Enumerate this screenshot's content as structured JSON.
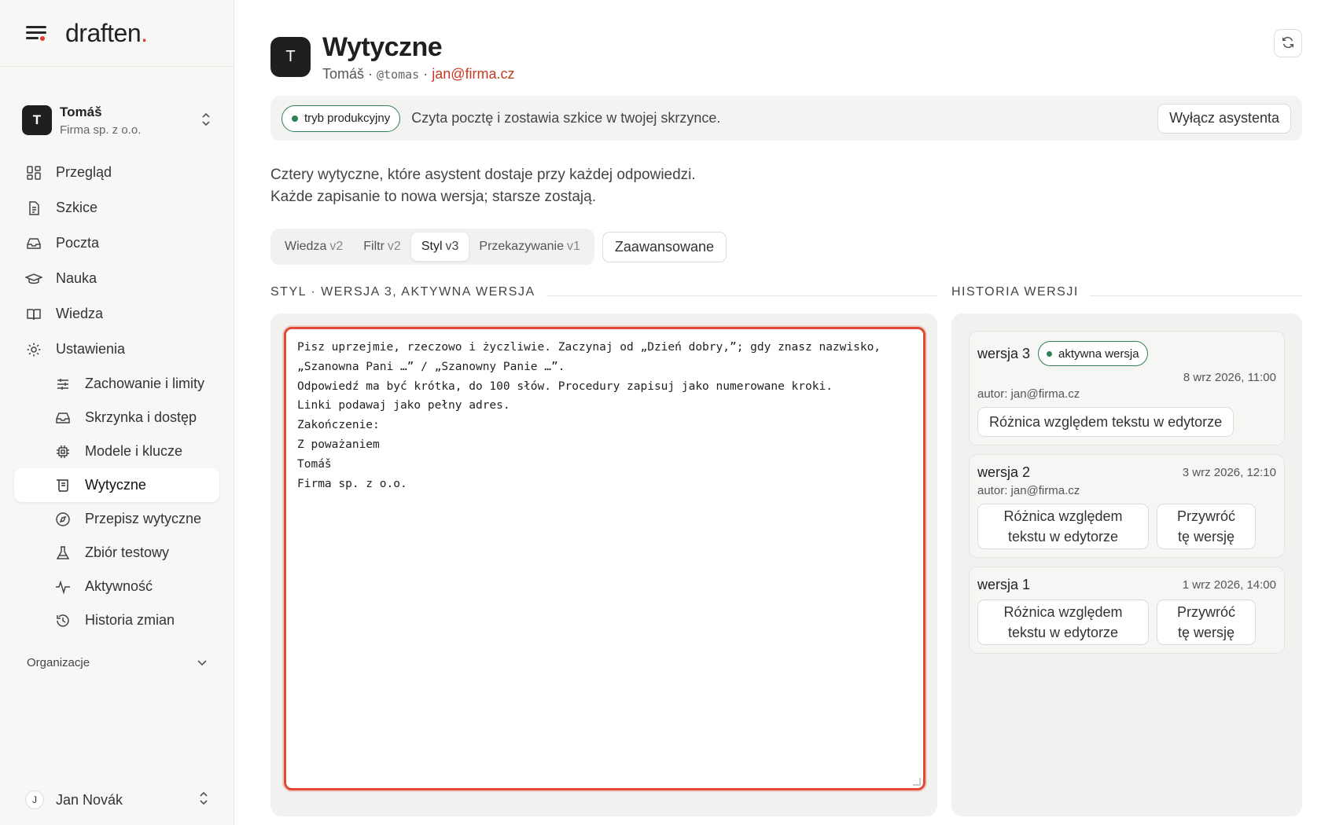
{
  "brand": {
    "name": "draften",
    "dot": "."
  },
  "account": {
    "initial": "T",
    "name": "Tomáš",
    "org": "Firma sp. z o.o."
  },
  "nav": {
    "items": [
      {
        "label": "Przegląd",
        "icon": "grid-icon"
      },
      {
        "label": "Szkice",
        "icon": "document-icon"
      },
      {
        "label": "Poczta",
        "icon": "inbox-icon"
      },
      {
        "label": "Nauka",
        "icon": "graduation-cap-icon"
      },
      {
        "label": "Wiedza",
        "icon": "book-icon"
      },
      {
        "label": "Ustawienia",
        "icon": "gear-icon"
      }
    ],
    "sub_items": [
      {
        "label": "Zachowanie i limity",
        "icon": "sliders-icon"
      },
      {
        "label": "Skrzynka i dostęp",
        "icon": "inbox-icon"
      },
      {
        "label": "Modele i klucze",
        "icon": "chip-icon"
      },
      {
        "label": "Wytyczne",
        "icon": "scroll-icon",
        "active": true
      },
      {
        "label": "Przepisz wytyczne",
        "icon": "compass-icon"
      },
      {
        "label": "Zbiór testowy",
        "icon": "flask-icon"
      },
      {
        "label": "Aktywność",
        "icon": "activity-icon"
      },
      {
        "label": "Historia zmian",
        "icon": "history-icon"
      }
    ],
    "orgs_label": "Organizacje"
  },
  "user": {
    "initial": "J",
    "name": "Jan Novák"
  },
  "header": {
    "initial": "T",
    "title": "Wytyczne",
    "name": "Tomáš",
    "sep1": " · ",
    "handle": "@tomas",
    "sep2": " · ",
    "email": "jan@firma.cz"
  },
  "banner": {
    "badge": "tryb produkcyjny",
    "text": "Czyta pocztę i zostawia szkice w twojej skrzynce.",
    "button": "Wyłącz asystenta"
  },
  "description": {
    "line1": "Cztery wytyczne, które asystent dostaje przy każdej odpowiedzi.",
    "line2": "Każde zapisanie to nowa wersja; starsze zostają."
  },
  "tabs": [
    {
      "label": "Wiedza",
      "version": "v2"
    },
    {
      "label": "Filtr",
      "version": "v2"
    },
    {
      "label": "Styl",
      "version": "v3",
      "active": true
    },
    {
      "label": "Przekazywanie",
      "version": "v1"
    }
  ],
  "advanced_button": "Zaawansowane",
  "editor": {
    "section_label": "STYL · WERSJA 3, AKTYWNA WERSJA",
    "text": "Pisz uprzejmie, rzeczowo i życzliwie. Zaczynaj od „Dzień dobry,”; gdy znasz nazwisko,\n„Szanowna Pani …” / „Szanowny Panie …”.\nOdpowiedź ma być krótka, do 100 słów. Procedury zapisuj jako numerowane kroki.\nLinki podawaj jako pełny adres.\nZakończenie:\nZ poważaniem\nTomáš\nFirma sp. z o.o."
  },
  "history": {
    "section_label": "HISTORIA WERSJI",
    "v3": {
      "label": "wersja 3",
      "badge": "aktywna wersja",
      "date": "8 wrz 2026, 11:00",
      "author": "autor: jan@firma.cz",
      "diff_button": "Różnica względem tekstu w edytorze"
    },
    "v2": {
      "label": "wersja 2",
      "date": "3 wrz 2026, 12:10",
      "author": "autor: jan@firma.cz",
      "diff_button_l1": "Różnica względem",
      "diff_button_l2": "tekstu w edytorze",
      "restore_l1": "Przywróć",
      "restore_l2": "tę wersję"
    },
    "v1": {
      "label": "wersja 1",
      "date": "1 wrz 2026, 14:00",
      "diff_button_l1": "Różnica względem",
      "diff_button_l2": "tekstu w edytorze",
      "restore_l1": "Przywróć",
      "restore_l2": "tę wersję"
    }
  },
  "colors": {
    "accent": "#dc3b25",
    "success": "#2d7f56",
    "editor_border": "#e04a35"
  }
}
